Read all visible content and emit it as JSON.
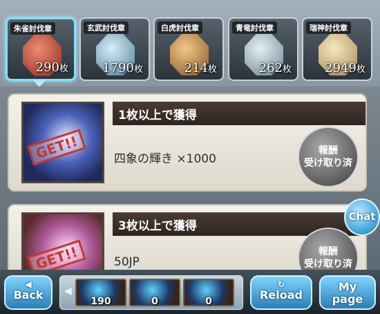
{
  "medal_tabs": [
    {
      "label": "朱雀討伐章",
      "count": "290",
      "unit": "枚",
      "color_from": "#f08a70",
      "color_to": "#8a2c1e"
    },
    {
      "label": "玄武討伐章",
      "count": "1790",
      "unit": "枚",
      "color_from": "#d7eef8",
      "color_to": "#4f7e99"
    },
    {
      "label": "白虎討伐章",
      "count": "214",
      "unit": "枚",
      "color_from": "#f2c68a",
      "color_to": "#8a5a26"
    },
    {
      "label": "青竜討伐章",
      "count": "262",
      "unit": "枚",
      "color_from": "#e4eff2",
      "color_to": "#6d8893"
    },
    {
      "label": "瑞神討伐章",
      "count": "2949",
      "unit": "枚",
      "color_from": "#f6e6c2",
      "color_to": "#a88b58"
    }
  ],
  "rewards": [
    {
      "condition": "1枚以上で獲得",
      "stamp": "GET!!",
      "item": "四象の輝き ×1000",
      "status_line1": "報酬",
      "status_line2": "受け取り済"
    },
    {
      "condition": "3枚以上で獲得",
      "stamp": "GET!!",
      "item": "50JP",
      "status_line1": "報酬",
      "status_line2": "受け取り済"
    }
  ],
  "chat": {
    "label": "Chat"
  },
  "footer": {
    "back_label": "Back",
    "reload_label": "Reload",
    "mypage_line1": "My",
    "mypage_line2": "page",
    "items": [
      {
        "icon": "fire-crystal-icon",
        "count": "190"
      },
      {
        "icon": "blue-crystal-icon",
        "count": "0"
      },
      {
        "icon": "blue-gem-icon",
        "count": "0"
      }
    ]
  }
}
